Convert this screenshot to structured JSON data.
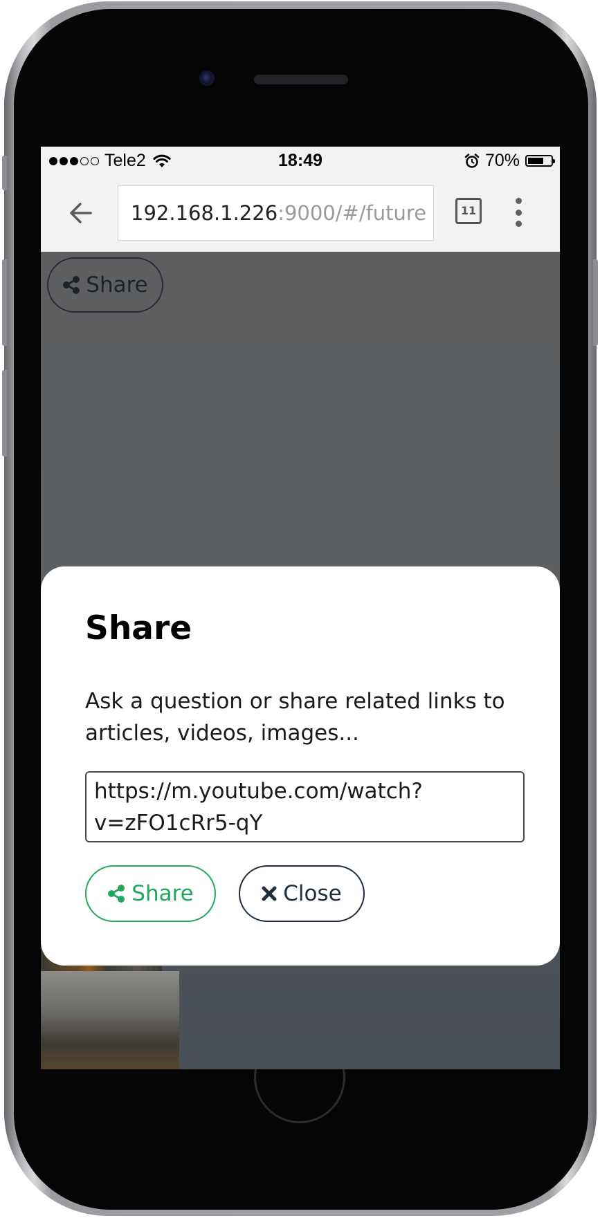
{
  "status_bar": {
    "carrier": "Tele2",
    "time": "18:49",
    "battery_percent": "70%",
    "signal_bars_filled": 3,
    "signal_bars_total": 5,
    "battery_level": 0.7
  },
  "browser": {
    "url_host": "192.168.1.226",
    "url_path": ":9000/#/future",
    "tab_count": "11"
  },
  "page": {
    "share_button_label": "Share"
  },
  "modal": {
    "title": "Share",
    "description": "Ask a question or share related links to articles, videos, images...",
    "input_value": "https://m.youtube.com/watch?v=zFO1cRr5-qY",
    "share_label": "Share",
    "close_label": "Close"
  },
  "colors": {
    "share_accent": "#22a85c",
    "close_accent": "#1f2d3d",
    "overlay_dim": "#5d6062"
  },
  "icons": [
    "signal-dots-icon",
    "wifi-icon",
    "alarm-icon",
    "battery-icon",
    "back-arrow-icon",
    "tabs-icon",
    "more-vert-icon",
    "share-icon",
    "close-x-icon"
  ]
}
